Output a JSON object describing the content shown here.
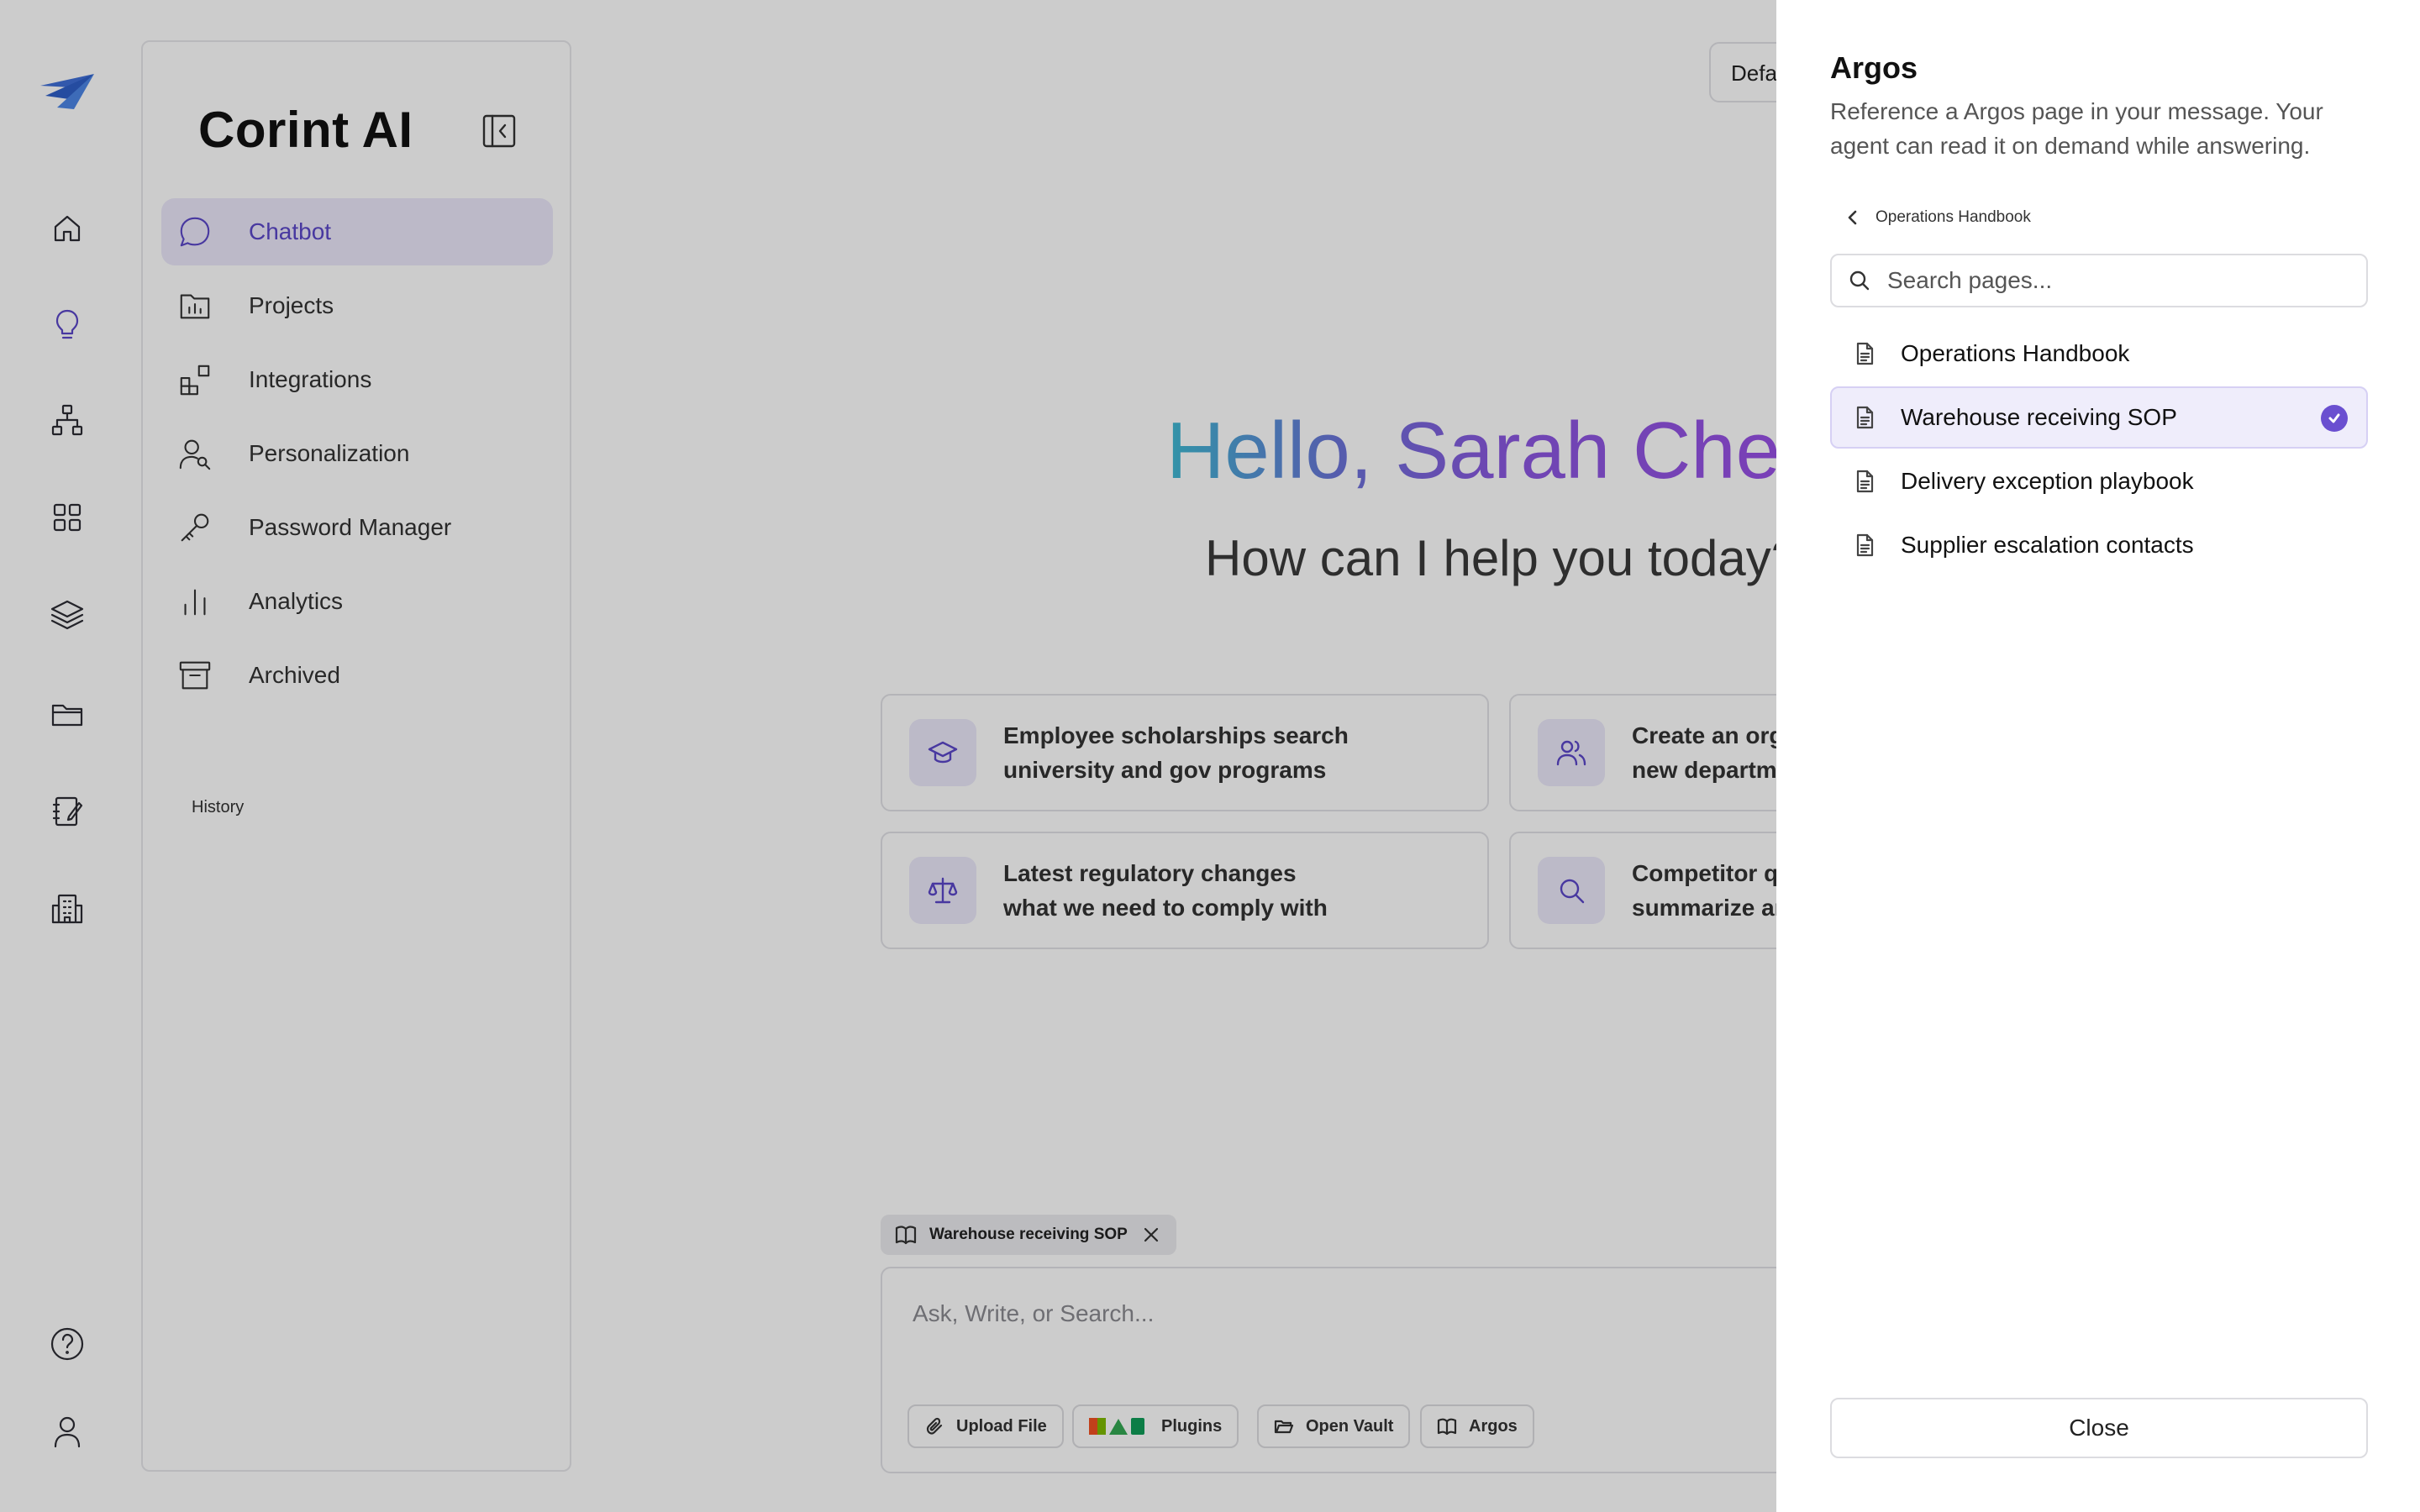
{
  "app": {
    "brand": "Corint AI"
  },
  "rail": {
    "icons": [
      "logo-icon",
      "home-icon",
      "lightbulb-icon",
      "org-chart-icon",
      "grid-icon",
      "layers-icon",
      "folder-icon",
      "notebook-icon",
      "building-icon",
      "help-icon",
      "user-icon"
    ],
    "active": "lightbulb-icon"
  },
  "sidebar": {
    "items": [
      {
        "label": "Chatbot",
        "icon": "chat-bubble-icon",
        "active": true
      },
      {
        "label": "Projects",
        "icon": "folder-chart-icon"
      },
      {
        "label": "Integrations",
        "icon": "blocks-icon"
      },
      {
        "label": "Personalization",
        "icon": "user-search-icon"
      },
      {
        "label": "Password Manager",
        "icon": "key-icon"
      },
      {
        "label": "Analytics",
        "icon": "bar-chart-icon"
      },
      {
        "label": "Archived",
        "icon": "archive-icon"
      }
    ],
    "history_label": "History"
  },
  "main": {
    "model_chip": "Defa",
    "greeting": "Hello, Sarah Chen",
    "subgreeting": "How can I help you today?",
    "cards": [
      {
        "line1": "Employee scholarships search",
        "line2": "university and gov programs",
        "icon": "graduation-cap-icon"
      },
      {
        "line1": "Create an org",
        "line2": "new departme",
        "icon": "users-icon"
      },
      {
        "line1": "Latest regulatory changes",
        "line2": "what we need to comply with",
        "icon": "scale-icon"
      },
      {
        "line1": "Competitor qu",
        "line2": "summarize an",
        "icon": "search-icon"
      }
    ],
    "attachment": {
      "label": "Warehouse receiving SOP"
    },
    "composer": {
      "placeholder": "Ask, Write, or Search...",
      "tools": {
        "upload": "Upload File",
        "plugins": "Plugins",
        "vault": "Open Vault",
        "argos": "Argos"
      }
    }
  },
  "drawer": {
    "title": "Argos",
    "description": "Reference a Argos page in your message. Your agent can read it on demand while answering.",
    "breadcrumb": "Operations Handbook",
    "search_placeholder": "Search pages...",
    "pages": [
      {
        "title": "Operations Handbook",
        "selected": false
      },
      {
        "title": "Warehouse receiving SOP",
        "selected": true
      },
      {
        "title": "Delivery exception playbook",
        "selected": false
      },
      {
        "title": "Supplier escalation contacts",
        "selected": false
      }
    ],
    "close_label": "Close"
  },
  "colors": {
    "accent": "#5a47c8",
    "check": "#6a4fd0",
    "selected_bg": "#efedfb",
    "greeting_start": "#3fbad3",
    "greeting_end": "#9b4fe6"
  }
}
